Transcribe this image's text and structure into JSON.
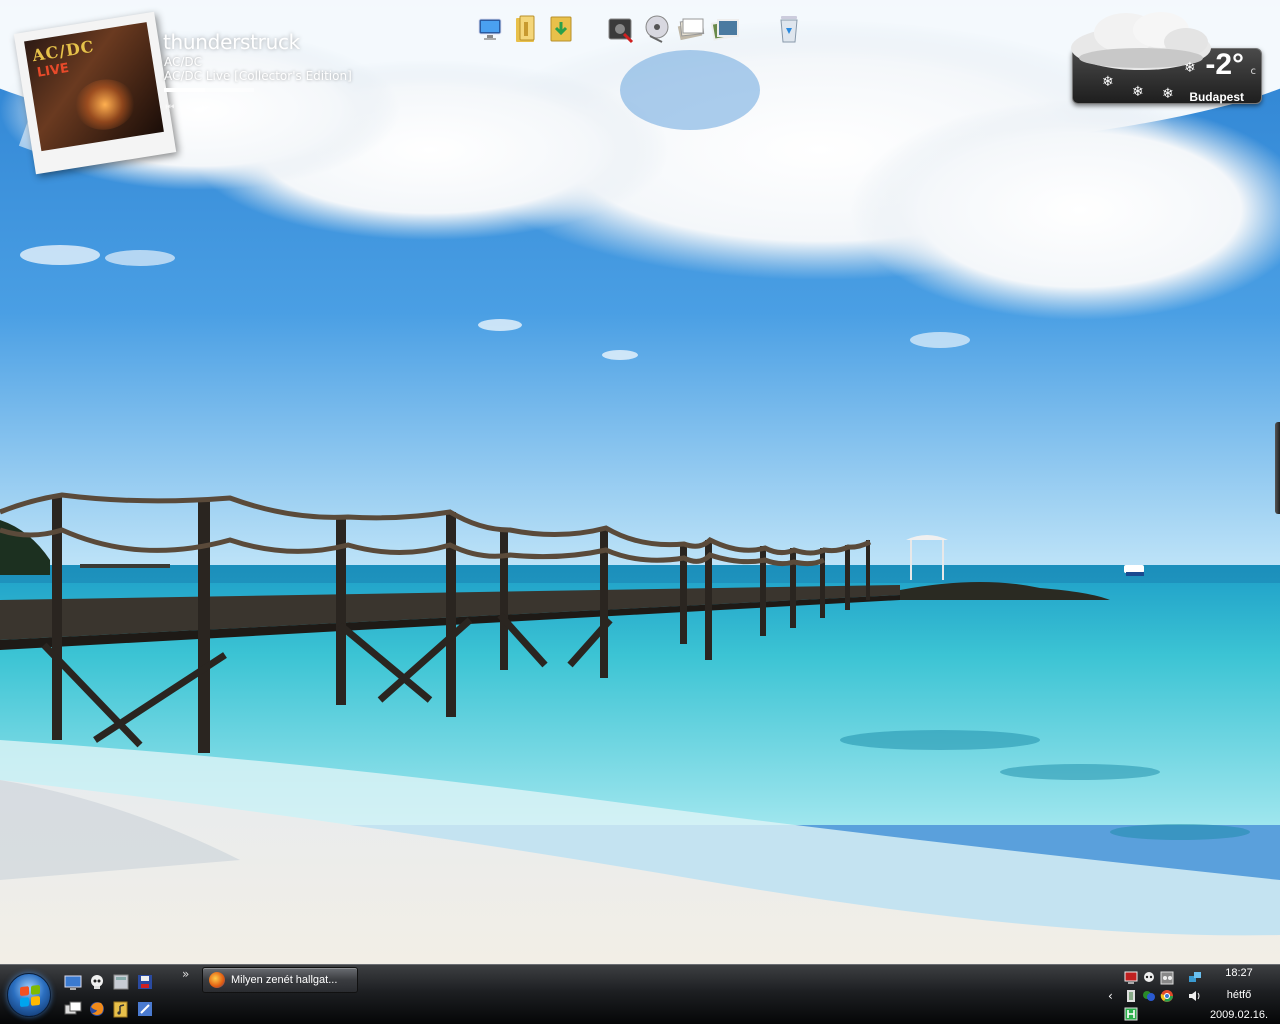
{
  "now_playing": {
    "title": "thunderstruck",
    "artist": "AC/DC",
    "album": "AC/DC Live [Collector's Edition]",
    "cover_logo": "AC/DC",
    "cover_sub": "LIVE",
    "progress": 0.46
  },
  "dock": {
    "icons": [
      "computer-icon",
      "folder-icon",
      "download-folder-icon",
      "media-player-icon",
      "disc-icon",
      "documents-icon",
      "pictures-icon",
      "recycle-bin-icon"
    ]
  },
  "weather": {
    "temperature": "-2°",
    "unit": "c",
    "city": "Budapest",
    "condition_icon": "snow-cloud-icon"
  },
  "taskbar": {
    "quick_launch_icons": [
      "show-desktop-icon",
      "skull-icon",
      "calculator-icon",
      "save-icon",
      "switch-windows-icon",
      "firefox-icon",
      "folder-music-icon",
      "tool-icon"
    ],
    "chevron": "»",
    "task_button_label": "Milyen zenét hallgat...",
    "tray_chevron": "‹",
    "clock_time": "18:27",
    "clock_day": "hétfő",
    "clock_date": "2009.02.16."
  },
  "colors": {
    "sky_top": "#2f86d6",
    "sea": "#4cc8d8",
    "sand": "#ece8e0",
    "taskbar": "#1d1f22"
  }
}
